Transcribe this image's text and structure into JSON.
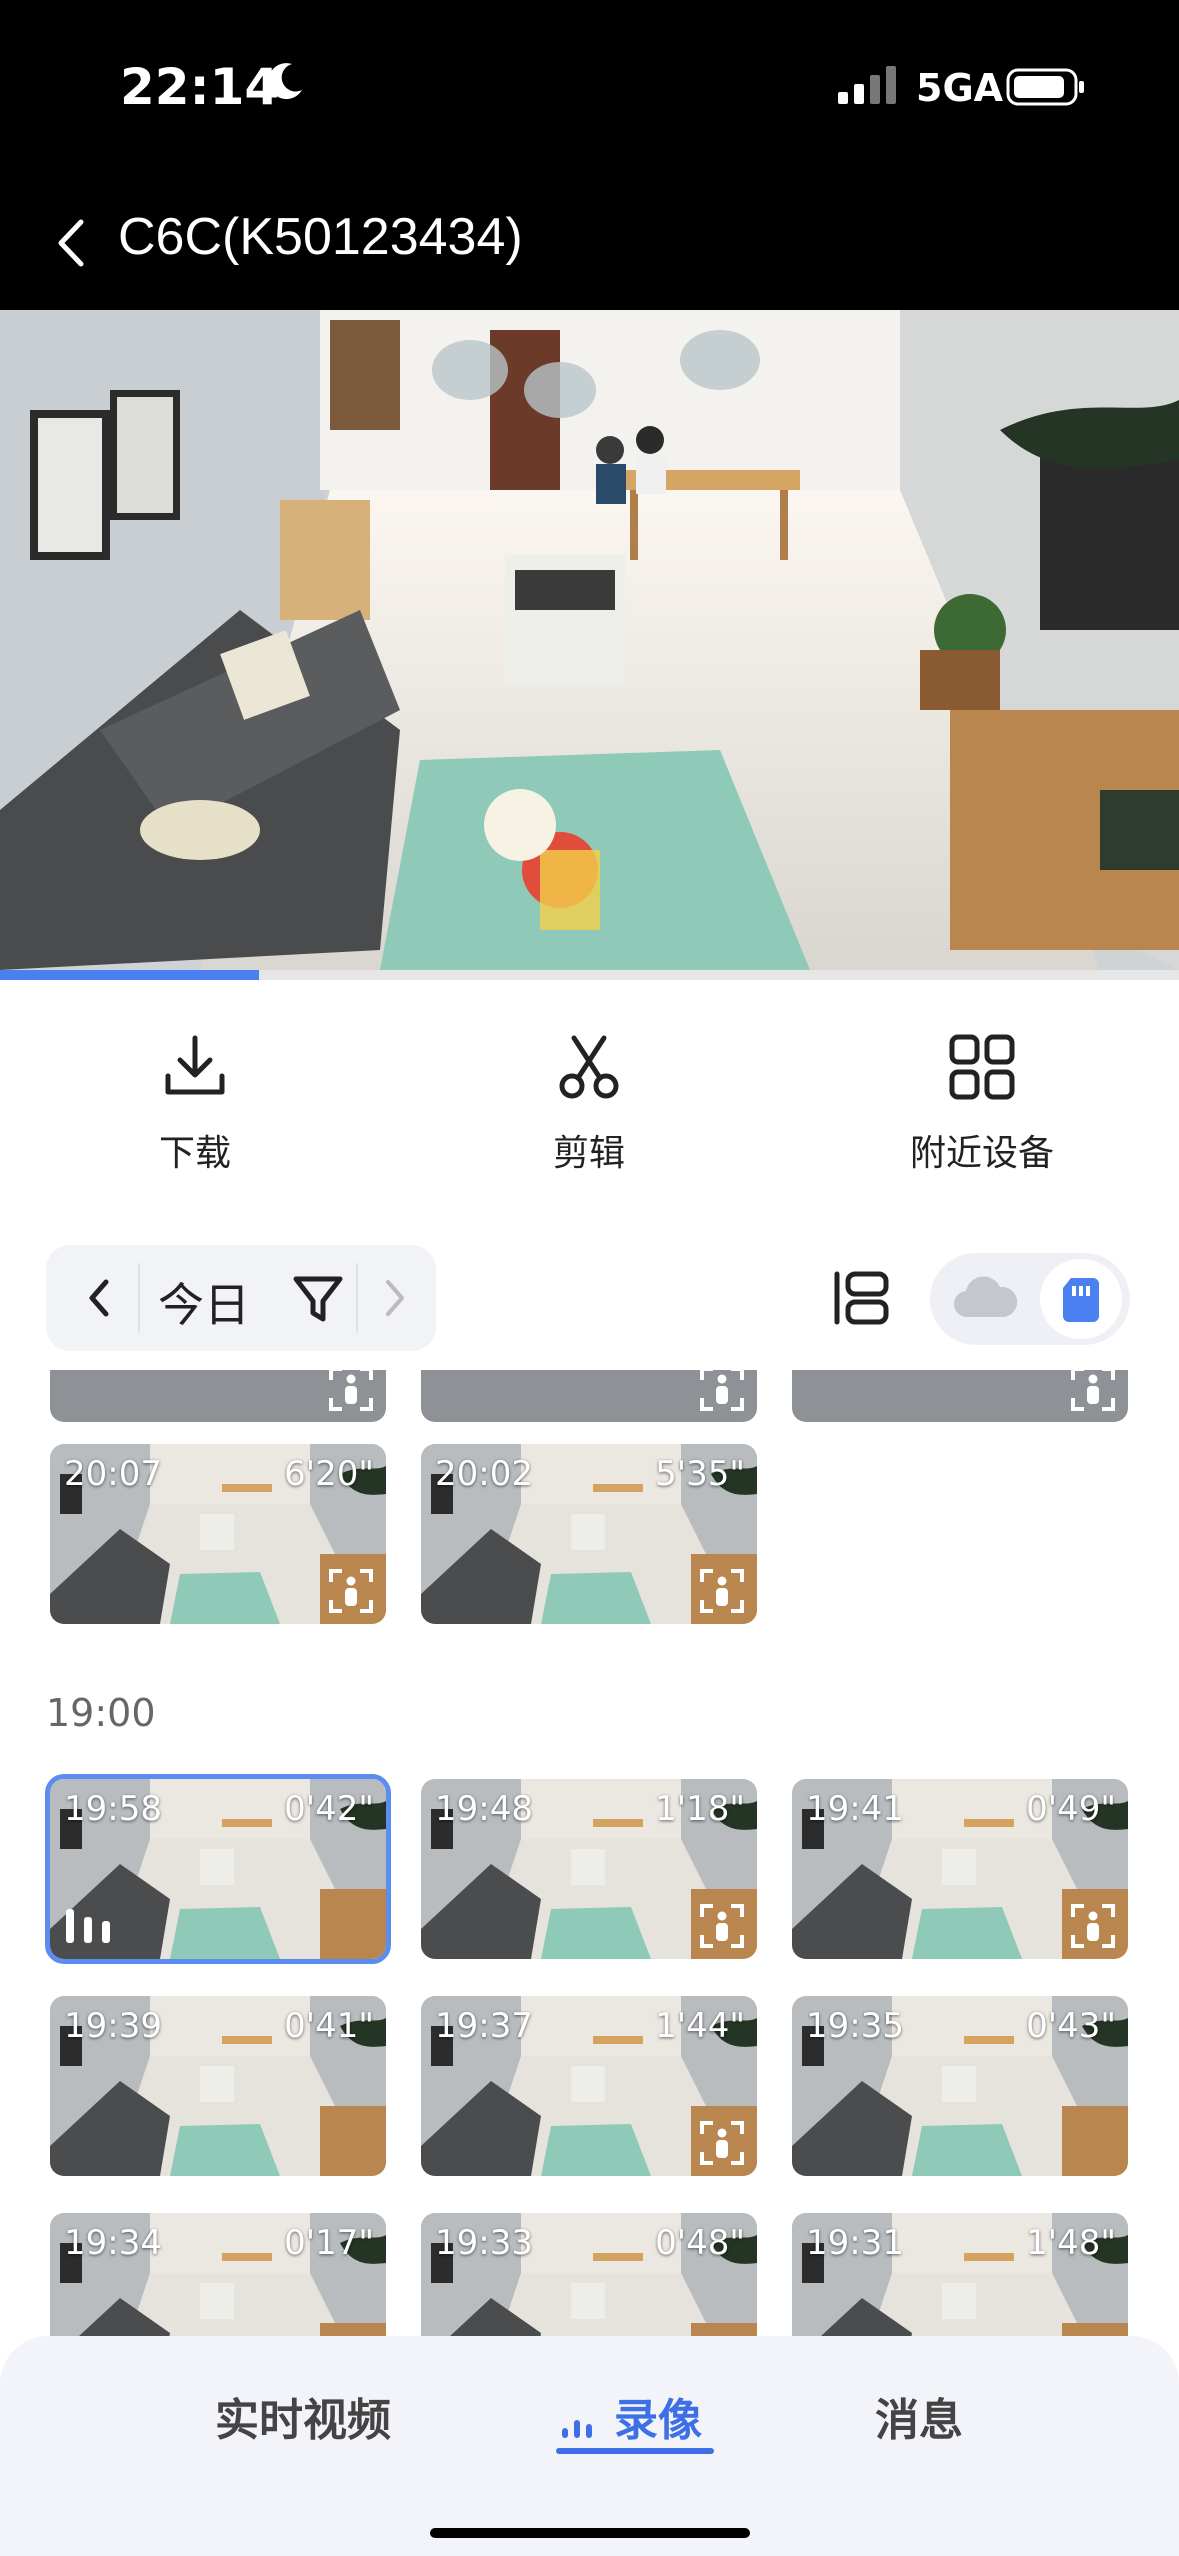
{
  "status": {
    "time": "22:14",
    "network": "5GA"
  },
  "header": {
    "title": "C6C(K50123434)"
  },
  "player": {
    "progress": 0.22
  },
  "actions": [
    {
      "label": "下载",
      "icon": "download-icon"
    },
    {
      "label": "剪辑",
      "icon": "scissors-icon"
    },
    {
      "label": "附近设备",
      "icon": "grid-icon"
    }
  ],
  "filter": {
    "date": "今日"
  },
  "storage": {
    "selected": "sd-card"
  },
  "groups": [
    {
      "label": "",
      "clips": [
        {
          "time": "",
          "duration": "",
          "partial": true,
          "person": true
        },
        {
          "time": "",
          "duration": "",
          "partial": true,
          "person": true
        },
        {
          "time": "",
          "duration": "",
          "partial": true,
          "person": true
        },
        {
          "time": "20:07",
          "duration": "6'20\"",
          "person": true
        },
        {
          "time": "20:02",
          "duration": "5'35\"",
          "person": true
        }
      ]
    },
    {
      "label": "19:00",
      "clips": [
        {
          "time": "19:58",
          "duration": "0'42\"",
          "selected": true,
          "playing": true
        },
        {
          "time": "19:48",
          "duration": "1'18\"",
          "person": true
        },
        {
          "time": "19:41",
          "duration": "0'49\"",
          "person": true
        },
        {
          "time": "19:39",
          "duration": "0'41\""
        },
        {
          "time": "19:37",
          "duration": "1'44\"",
          "person": true
        },
        {
          "time": "19:35",
          "duration": "0'43\""
        },
        {
          "time": "19:34",
          "duration": "0'17\""
        },
        {
          "time": "19:33",
          "duration": "0'48\""
        },
        {
          "time": "19:31",
          "duration": "1'48\""
        }
      ]
    }
  ],
  "tabs": [
    {
      "label": "实时视频",
      "active": false
    },
    {
      "label": "录像",
      "active": true
    },
    {
      "label": "消息",
      "active": false
    }
  ],
  "colors": {
    "accent": "#3f6fe6",
    "selection": "#5b8def"
  }
}
